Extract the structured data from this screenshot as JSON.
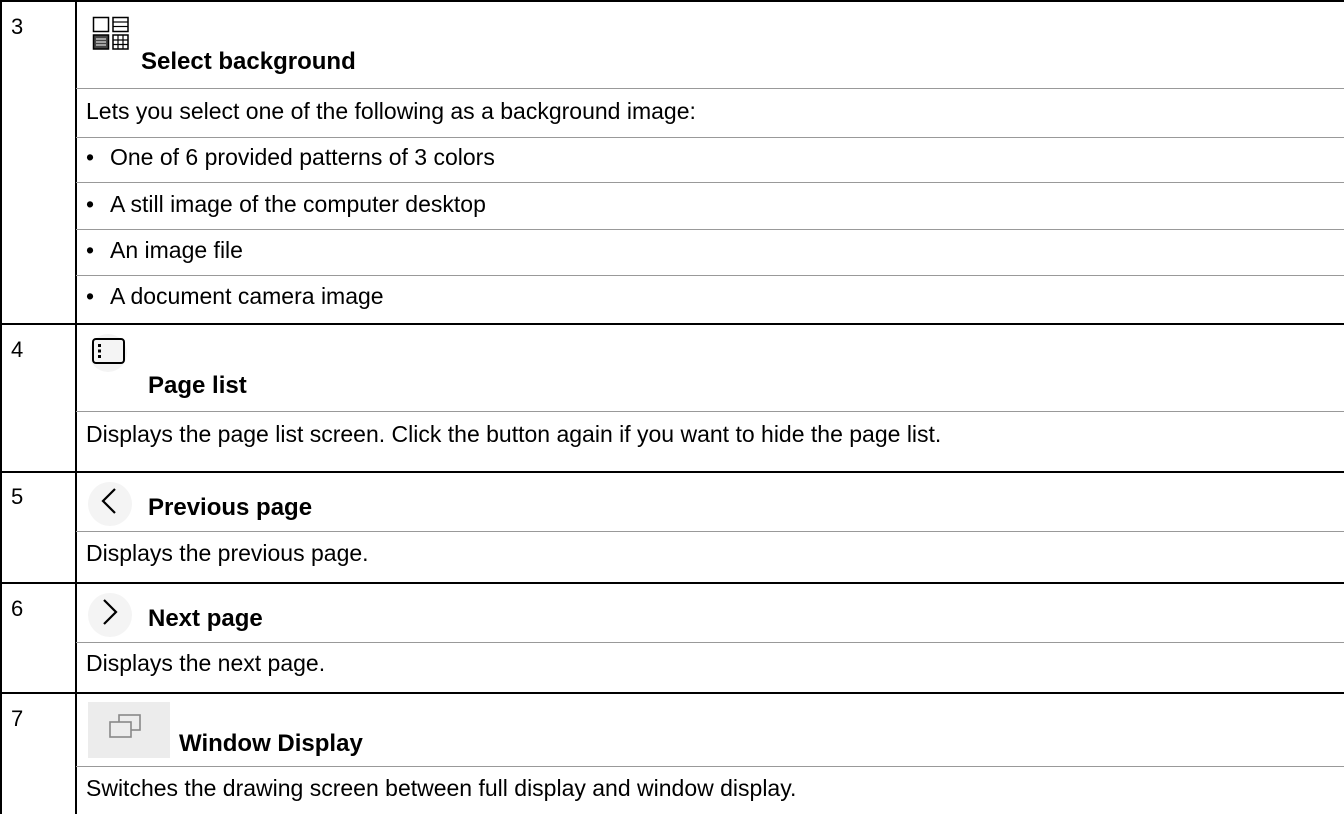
{
  "rows": [
    {
      "number": "3",
      "icon": "select-background-icon",
      "title": "Select background",
      "description": "Lets you select one of the following as a background image:",
      "bullets": [
        "One of 6 provided patterns of 3 colors",
        "A still image of the computer desktop",
        "An image file",
        "A document camera image"
      ]
    },
    {
      "number": "4",
      "icon": "page-list-icon",
      "title": "Page list",
      "description": "Displays the page list screen. Click the button again if you want to hide the page list."
    },
    {
      "number": "5",
      "icon": "chevron-left-icon",
      "title": "Previous page",
      "description": "Displays the previous page."
    },
    {
      "number": "6",
      "icon": "chevron-right-icon",
      "title": "Next page",
      "description": "Displays the next page."
    },
    {
      "number": "7",
      "icon": "window-display-icon",
      "title": "Window Display",
      "description": "Switches the drawing screen between full display and window display."
    }
  ]
}
